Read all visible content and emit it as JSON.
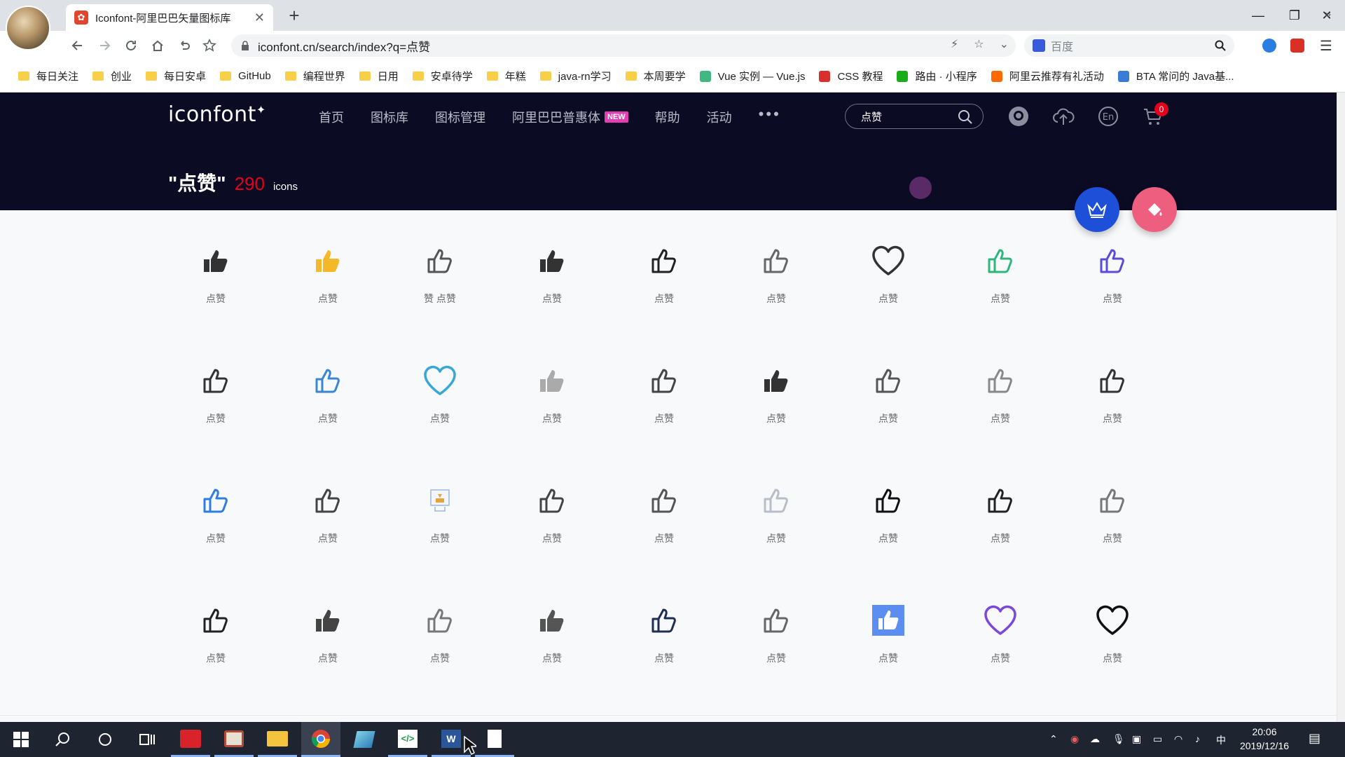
{
  "browser": {
    "tab_title": "Iconfont-阿里巴巴矢量图标库",
    "url": "iconfont.cn/search/index?q=点赞",
    "search_engine_placeholder": "百度"
  },
  "bookmarks": [
    {
      "label": "每日关注",
      "icon": "folder"
    },
    {
      "label": "创业",
      "icon": "folder"
    },
    {
      "label": "每日安卓",
      "icon": "folder"
    },
    {
      "label": "GitHub",
      "icon": "folder"
    },
    {
      "label": "编程世界",
      "icon": "folder"
    },
    {
      "label": "日用",
      "icon": "folder"
    },
    {
      "label": "安卓待学",
      "icon": "folder"
    },
    {
      "label": "年糕",
      "icon": "folder"
    },
    {
      "label": "java-rn学习",
      "icon": "folder"
    },
    {
      "label": "本周要学",
      "icon": "folder"
    },
    {
      "label": "Vue 实例 — Vue.js",
      "icon": "vue-icon"
    },
    {
      "label": "CSS 教程",
      "icon": "css-icon"
    },
    {
      "label": "路由 · 小程序",
      "icon": "wechat-icon"
    },
    {
      "label": "阿里云推荐有礼活动",
      "icon": "aliyun-icon"
    },
    {
      "label": "BTA 常问的 Java基...",
      "icon": "bta-icon"
    }
  ],
  "site": {
    "logo": "iconfont",
    "nav": [
      "首页",
      "图标库",
      "图标管理",
      "阿里巴巴普惠体",
      "帮助",
      "活动"
    ],
    "new_badge": "NEW",
    "search_value": "点赞",
    "cart_count": "0",
    "result_query": "\"点赞\"",
    "result_count": "290",
    "result_unit": "icons"
  },
  "icons": [
    {
      "label": "点赞",
      "kind": "thumb-filled",
      "color": "#333333"
    },
    {
      "label": "点赞",
      "kind": "thumb-filled",
      "color": "#f5b829"
    },
    {
      "label": "赞 点赞",
      "kind": "thumb-outline",
      "color": "#555555"
    },
    {
      "label": "点赞",
      "kind": "thumb-filled",
      "color": "#333333"
    },
    {
      "label": "点赞",
      "kind": "thumb-outline",
      "color": "#222222"
    },
    {
      "label": "点赞",
      "kind": "thumb-outline",
      "color": "#666666"
    },
    {
      "label": "点赞",
      "kind": "heart-outline",
      "color": "#333333"
    },
    {
      "label": "点赞",
      "kind": "thumb-outline",
      "color": "#2fb67a"
    },
    {
      "label": "点赞",
      "kind": "thumb-outline",
      "color": "#5b4bd6"
    },
    {
      "label": "点赞",
      "kind": "thumb-outline",
      "color": "#333333"
    },
    {
      "label": "点赞",
      "kind": "thumb-outline",
      "color": "#3a86d6"
    },
    {
      "label": "点赞",
      "kind": "heart-outline",
      "color": "#3aa6d6"
    },
    {
      "label": "点赞",
      "kind": "thumb-filled",
      "color": "#aaaaaa"
    },
    {
      "label": "点赞",
      "kind": "thumb-outline",
      "color": "#444444"
    },
    {
      "label": "点赞",
      "kind": "thumb-filled",
      "color": "#333333"
    },
    {
      "label": "点赞",
      "kind": "thumb-outline",
      "color": "#555555"
    },
    {
      "label": "点赞",
      "kind": "thumb-outline",
      "color": "#888888"
    },
    {
      "label": "点赞",
      "kind": "thumb-outline",
      "color": "#333333"
    },
    {
      "label": "点赞",
      "kind": "thumb-outline",
      "color": "#2f7de1"
    },
    {
      "label": "点赞",
      "kind": "thumb-outline",
      "color": "#444444"
    },
    {
      "label": "点赞",
      "kind": "badge-like",
      "color": "#e9a23b"
    },
    {
      "label": "点赞",
      "kind": "thumb-outline",
      "color": "#444444"
    },
    {
      "label": "点赞",
      "kind": "thumb-outline",
      "color": "#555555"
    },
    {
      "label": "点赞",
      "kind": "thumb-outline",
      "color": "#b8bec9"
    },
    {
      "label": "点赞",
      "kind": "thumb-outline",
      "color": "#111111"
    },
    {
      "label": "点赞",
      "kind": "thumb-outline",
      "color": "#222222"
    },
    {
      "label": "点赞",
      "kind": "thumb-outline",
      "color": "#777777"
    },
    {
      "label": "点赞",
      "kind": "thumb-outline",
      "color": "#222222"
    },
    {
      "label": "点赞",
      "kind": "thumb-filled",
      "color": "#444444"
    },
    {
      "label": "点赞",
      "kind": "thumb-outline",
      "color": "#777777"
    },
    {
      "label": "点赞",
      "kind": "thumb-filled",
      "color": "#555555"
    },
    {
      "label": "点赞",
      "kind": "thumb-outline",
      "color": "#1f2e55"
    },
    {
      "label": "点赞",
      "kind": "thumb-outline",
      "color": "#666666"
    },
    {
      "label": "点赞",
      "kind": "thumb-box",
      "color": "#5b8ef0"
    },
    {
      "label": "点赞",
      "kind": "heart-outline",
      "color": "#7a49d9"
    },
    {
      "label": "点赞",
      "kind": "heart-outline",
      "color": "#111111"
    }
  ],
  "taskbar": {
    "input_method": "中",
    "time": "20:06",
    "date": "2019/12/16"
  }
}
